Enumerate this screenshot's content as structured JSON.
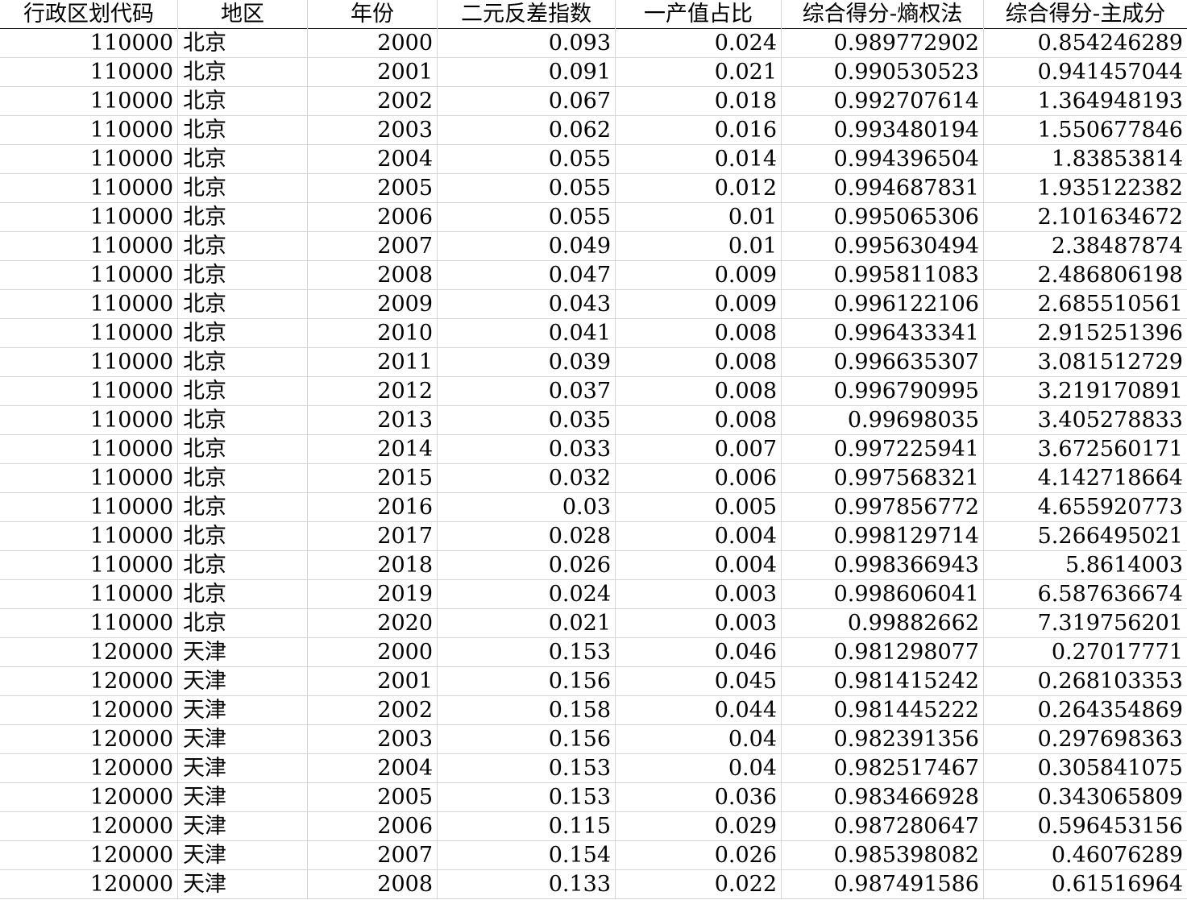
{
  "table": {
    "headers": [
      "行政区划代码",
      "地区",
      "年份",
      "二元反差指数",
      "一产值占比",
      "综合得分-熵权法",
      "综合得分-主成分"
    ],
    "rows": [
      [
        "110000",
        "北京",
        "2000",
        "0.093",
        "0.024",
        "0.989772902",
        "0.854246289"
      ],
      [
        "110000",
        "北京",
        "2001",
        "0.091",
        "0.021",
        "0.990530523",
        "0.941457044"
      ],
      [
        "110000",
        "北京",
        "2002",
        "0.067",
        "0.018",
        "0.992707614",
        "1.364948193"
      ],
      [
        "110000",
        "北京",
        "2003",
        "0.062",
        "0.016",
        "0.993480194",
        "1.550677846"
      ],
      [
        "110000",
        "北京",
        "2004",
        "0.055",
        "0.014",
        "0.994396504",
        "1.83853814"
      ],
      [
        "110000",
        "北京",
        "2005",
        "0.055",
        "0.012",
        "0.994687831",
        "1.935122382"
      ],
      [
        "110000",
        "北京",
        "2006",
        "0.055",
        "0.01",
        "0.995065306",
        "2.101634672"
      ],
      [
        "110000",
        "北京",
        "2007",
        "0.049",
        "0.01",
        "0.995630494",
        "2.38487874"
      ],
      [
        "110000",
        "北京",
        "2008",
        "0.047",
        "0.009",
        "0.995811083",
        "2.486806198"
      ],
      [
        "110000",
        "北京",
        "2009",
        "0.043",
        "0.009",
        "0.996122106",
        "2.685510561"
      ],
      [
        "110000",
        "北京",
        "2010",
        "0.041",
        "0.008",
        "0.996433341",
        "2.915251396"
      ],
      [
        "110000",
        "北京",
        "2011",
        "0.039",
        "0.008",
        "0.996635307",
        "3.081512729"
      ],
      [
        "110000",
        "北京",
        "2012",
        "0.037",
        "0.008",
        "0.996790995",
        "3.219170891"
      ],
      [
        "110000",
        "北京",
        "2013",
        "0.035",
        "0.008",
        "0.99698035",
        "3.405278833"
      ],
      [
        "110000",
        "北京",
        "2014",
        "0.033",
        "0.007",
        "0.997225941",
        "3.672560171"
      ],
      [
        "110000",
        "北京",
        "2015",
        "0.032",
        "0.006",
        "0.997568321",
        "4.142718664"
      ],
      [
        "110000",
        "北京",
        "2016",
        "0.03",
        "0.005",
        "0.997856772",
        "4.655920773"
      ],
      [
        "110000",
        "北京",
        "2017",
        "0.028",
        "0.004",
        "0.998129714",
        "5.266495021"
      ],
      [
        "110000",
        "北京",
        "2018",
        "0.026",
        "0.004",
        "0.998366943",
        "5.8614003"
      ],
      [
        "110000",
        "北京",
        "2019",
        "0.024",
        "0.003",
        "0.998606041",
        "6.587636674"
      ],
      [
        "110000",
        "北京",
        "2020",
        "0.021",
        "0.003",
        "0.99882662",
        "7.319756201"
      ],
      [
        "120000",
        "天津",
        "2000",
        "0.153",
        "0.046",
        "0.981298077",
        "0.27017771"
      ],
      [
        "120000",
        "天津",
        "2001",
        "0.156",
        "0.045",
        "0.981415242",
        "0.268103353"
      ],
      [
        "120000",
        "天津",
        "2002",
        "0.158",
        "0.044",
        "0.981445222",
        "0.264354869"
      ],
      [
        "120000",
        "天津",
        "2003",
        "0.156",
        "0.04",
        "0.982391356",
        "0.297698363"
      ],
      [
        "120000",
        "天津",
        "2004",
        "0.153",
        "0.04",
        "0.982517467",
        "0.305841075"
      ],
      [
        "120000",
        "天津",
        "2005",
        "0.153",
        "0.036",
        "0.983466928",
        "0.343065809"
      ],
      [
        "120000",
        "天津",
        "2006",
        "0.115",
        "0.029",
        "0.987280647",
        "0.596453156"
      ],
      [
        "120000",
        "天津",
        "2007",
        "0.154",
        "0.026",
        "0.985398082",
        "0.46076289"
      ],
      [
        "120000",
        "天津",
        "2008",
        "0.133",
        "0.022",
        "0.987491586",
        "0.61516964"
      ]
    ]
  }
}
